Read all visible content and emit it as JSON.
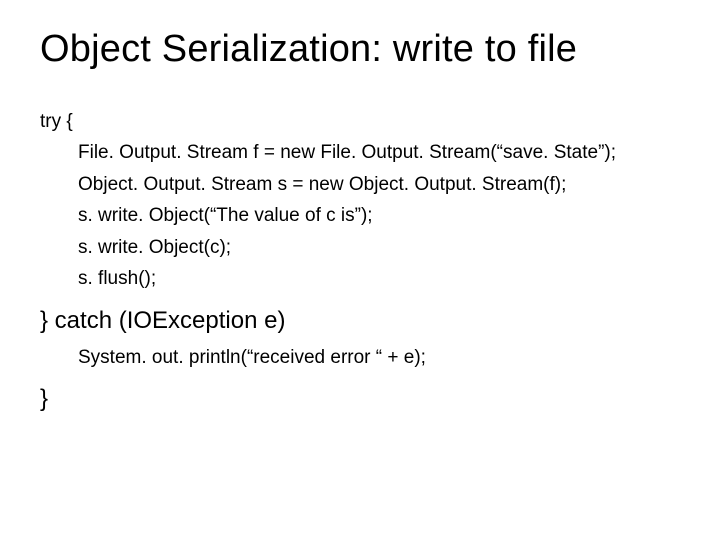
{
  "title": "Object Serialization: write to file",
  "code": {
    "try_open": "try {",
    "lines": [
      "File. Output. Stream f = new File. Output. Stream(“save. State”);",
      "Object. Output. Stream s = new Object. Output. Stream(f);",
      "s. write. Object(“The value of c is”);",
      "s. write. Object(c);",
      "s. flush();"
    ],
    "catch_line": "} catch (IOException e)",
    "catch_body": "System. out. println(“received error “ + e);",
    "close": "}"
  }
}
